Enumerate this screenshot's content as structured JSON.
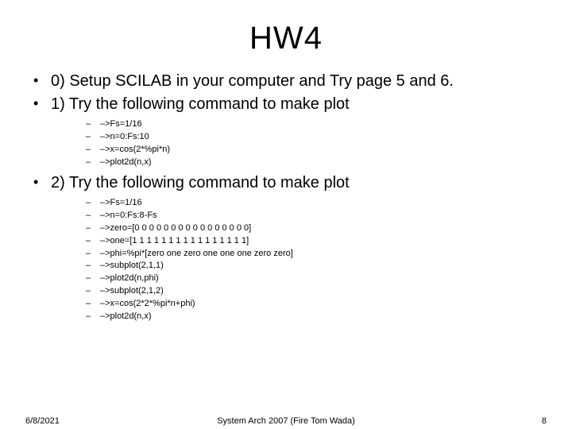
{
  "title": "HW4",
  "bullets": [
    {
      "text": "0) Setup SCILAB in your computer and Try page 5 and 6."
    },
    {
      "text": "1) Try the following command to make plot",
      "sub": [
        "–>Fs=1/16",
        "–>n=0:Fs:10",
        "–>x=cos(2*%pi*n)",
        "–>plot2d(n,x)"
      ]
    },
    {
      "text": "2) Try the following command to make plot",
      "sub": [
        "–>Fs=1/16",
        "–>n=0:Fs:8-Fs",
        "–>zero=[0 0 0 0 0 0 0 0 0 0 0 0 0 0 0 0]",
        "–>one=[1 1 1 1 1 1 1 1 1 1 1 1 1 1 1 1]",
        "–>phi=%pi*[zero one zero one one one zero zero]",
        "–>subplot(2,1,1)",
        "–>plot2d(n,phi)",
        "–>subplot(2,1,2)",
        "–>x=cos(2*2*%pi*n+phi)",
        "–>plot2d(n,x)"
      ]
    }
  ],
  "footer": {
    "date": "6/8/2021",
    "center": "System Arch 2007 (Fire Tom Wada)",
    "page": "8"
  }
}
